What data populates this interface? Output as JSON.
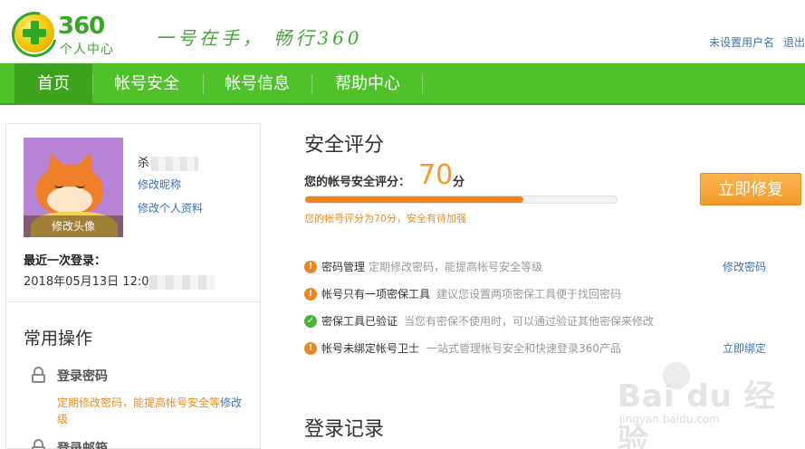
{
  "header": {
    "logo_number": "360",
    "logo_subtitle": "个人中心",
    "slogan": "一号在手， 畅行360",
    "links": [
      "未设置用户名",
      "退出"
    ]
  },
  "nav": {
    "items": [
      "首页",
      "帐号安全",
      "帐号信息",
      "帮助中心"
    ],
    "active": "首页"
  },
  "profile": {
    "avatar_caption": "修改头像",
    "username_visible": "杀",
    "edit_nickname": "修改昵称",
    "edit_profile": "修改个人资料",
    "last_login_label": "最近一次登录：",
    "last_login_visible": "2018年05月13日 12:0"
  },
  "common_ops": {
    "title": "常用操作",
    "items": [
      {
        "name": "登录密码",
        "desc": "定期修改密码，能提高帐号安全等级",
        "action": "修改"
      },
      {
        "name": "登录邮箱",
        "desc": "",
        "action": ""
      }
    ]
  },
  "security": {
    "title": "安全评分",
    "score_label": "您的帐号安全评分：",
    "score": "70",
    "score_unit": "分",
    "progress_percent": 70,
    "note": "您的帐号评分为70分，安全有待加强",
    "fix_button": "立即修复",
    "tips": [
      {
        "status": "warn",
        "title": "密码管理",
        "desc": "定期修改密码，能提高帐号安全等级",
        "action": "修改密码"
      },
      {
        "status": "warn",
        "title": "帐号只有一项密保工具",
        "desc": "建议您设置两项密保工具便于找回密码",
        "action": ""
      },
      {
        "status": "ok",
        "title": "密保工具已验证",
        "desc": "当您有密保不使用时，可以通过验证其他密保来修改",
        "action": ""
      },
      {
        "status": "warn",
        "title": "帐号未绑定帐号卫士",
        "desc": "一站式管理帐号安全和快速登录360产品",
        "action": "立即绑定"
      }
    ]
  },
  "login_records": {
    "title": "登录记录"
  },
  "watermark": {
    "brand": "Bai du 经验",
    "url": "jingyan.baidu.com"
  },
  "colors": {
    "nav_green": "#4ec12b",
    "accent_orange": "#f39a2c",
    "link_blue": "#3a73b8"
  }
}
